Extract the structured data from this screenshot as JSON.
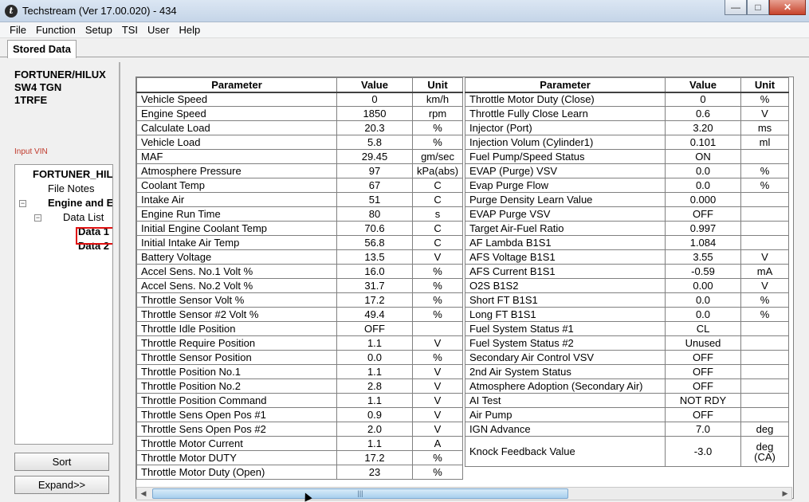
{
  "window": {
    "title": "Techstream (Ver 17.00.020) - 434",
    "minimize_icon": "minimize-icon",
    "maximize_icon": "maximize-icon",
    "close_icon": "close-icon"
  },
  "menu": [
    "File",
    "Function",
    "Setup",
    "TSI",
    "User",
    "Help"
  ],
  "tab": {
    "label": "Stored Data"
  },
  "vehicle": {
    "line1": "FORTUNER/HILUX",
    "line2": "SW4 TGN",
    "line3": "1TRFE"
  },
  "input_vin_label": "Input VIN",
  "tree": {
    "root": "FORTUNER_HIL",
    "file_notes": "File Notes",
    "engine": "Engine and E",
    "data_list": "Data List",
    "data1": "Data 1",
    "data2": "Data 2"
  },
  "buttons": {
    "sort": "Sort",
    "expand": "Expand>>"
  },
  "table_headers": {
    "parameter": "Parameter",
    "value": "Value",
    "unit": "Unit"
  },
  "left_rows": [
    {
      "param": "Vehicle Speed",
      "value": "0",
      "unit": "km/h"
    },
    {
      "param": "Engine Speed",
      "value": "1850",
      "unit": "rpm"
    },
    {
      "param": "Calculate Load",
      "value": "20.3",
      "unit": "%"
    },
    {
      "param": "Vehicle Load",
      "value": "5.8",
      "unit": "%"
    },
    {
      "param": "MAF",
      "value": "29.45",
      "unit": "gm/sec"
    },
    {
      "param": "Atmosphere Pressure",
      "value": "97",
      "unit": "kPa(abs)"
    },
    {
      "param": "Coolant Temp",
      "value": "67",
      "unit": "C"
    },
    {
      "param": "Intake Air",
      "value": "51",
      "unit": "C"
    },
    {
      "param": "Engine Run Time",
      "value": "80",
      "unit": "s"
    },
    {
      "param": "Initial Engine Coolant Temp",
      "value": "70.6",
      "unit": "C"
    },
    {
      "param": "Initial Intake Air Temp",
      "value": "56.8",
      "unit": "C"
    },
    {
      "param": "Battery Voltage",
      "value": "13.5",
      "unit": "V"
    },
    {
      "param": "Accel Sens. No.1 Volt %",
      "value": "16.0",
      "unit": "%"
    },
    {
      "param": "Accel Sens. No.2 Volt %",
      "value": "31.7",
      "unit": "%"
    },
    {
      "param": "Throttle Sensor Volt %",
      "value": "17.2",
      "unit": "%"
    },
    {
      "param": "Throttle Sensor #2 Volt %",
      "value": "49.4",
      "unit": "%"
    },
    {
      "param": "Throttle Idle Position",
      "value": "OFF",
      "unit": ""
    },
    {
      "param": "Throttle Require Position",
      "value": "1.1",
      "unit": "V"
    },
    {
      "param": "Throttle Sensor Position",
      "value": "0.0",
      "unit": "%"
    },
    {
      "param": "Throttle Position No.1",
      "value": "1.1",
      "unit": "V"
    },
    {
      "param": "Throttle Position No.2",
      "value": "2.8",
      "unit": "V"
    },
    {
      "param": "Throttle Position Command",
      "value": "1.1",
      "unit": "V"
    },
    {
      "param": "Throttle Sens Open Pos #1",
      "value": "0.9",
      "unit": "V"
    },
    {
      "param": "Throttle Sens Open Pos #2",
      "value": "2.0",
      "unit": "V"
    },
    {
      "param": "Throttle Motor Current",
      "value": "1.1",
      "unit": "A"
    },
    {
      "param": "Throttle Motor DUTY",
      "value": "17.2",
      "unit": "%"
    },
    {
      "param": "Throttle Motor Duty (Open)",
      "value": "23",
      "unit": "%"
    }
  ],
  "right_rows": [
    {
      "param": "Throttle Motor Duty (Close)",
      "value": "0",
      "unit": "%"
    },
    {
      "param": "Throttle Fully Close Learn",
      "value": "0.6",
      "unit": "V"
    },
    {
      "param": "Injector (Port)",
      "value": "3.20",
      "unit": "ms"
    },
    {
      "param": "Injection Volum (Cylinder1)",
      "value": "0.101",
      "unit": "ml"
    },
    {
      "param": "Fuel Pump/Speed Status",
      "value": "ON",
      "unit": ""
    },
    {
      "param": "EVAP (Purge) VSV",
      "value": "0.0",
      "unit": "%"
    },
    {
      "param": "Evap Purge Flow",
      "value": "0.0",
      "unit": "%"
    },
    {
      "param": "Purge Density Learn Value",
      "value": "0.000",
      "unit": ""
    },
    {
      "param": "EVAP Purge VSV",
      "value": "OFF",
      "unit": ""
    },
    {
      "param": "Target Air-Fuel Ratio",
      "value": "0.997",
      "unit": ""
    },
    {
      "param": "AF Lambda B1S1",
      "value": "1.084",
      "unit": ""
    },
    {
      "param": "AFS Voltage B1S1",
      "value": "3.55",
      "unit": "V"
    },
    {
      "param": "AFS Current B1S1",
      "value": "-0.59",
      "unit": "mA"
    },
    {
      "param": "O2S B1S2",
      "value": "0.00",
      "unit": "V"
    },
    {
      "param": "Short FT B1S1",
      "value": "0.0",
      "unit": "%"
    },
    {
      "param": "Long FT B1S1",
      "value": "0.0",
      "unit": "%"
    },
    {
      "param": "Fuel System Status #1",
      "value": "CL",
      "unit": ""
    },
    {
      "param": "Fuel System Status #2",
      "value": "Unused",
      "unit": ""
    },
    {
      "param": "Secondary Air Control VSV",
      "value": "OFF",
      "unit": ""
    },
    {
      "param": "2nd Air System Status",
      "value": "OFF",
      "unit": ""
    },
    {
      "param": "Atmosphere Adoption (Secondary Air)",
      "value": "OFF",
      "unit": ""
    },
    {
      "param": "AI Test",
      "value": "NOT RDY",
      "unit": ""
    },
    {
      "param": "Air Pump",
      "value": "OFF",
      "unit": ""
    },
    {
      "param": "IGN Advance",
      "value": "7.0",
      "unit": "deg"
    },
    {
      "param": "Knock Feedback Value",
      "value": "-3.0",
      "unit": "deg (CA)"
    }
  ],
  "scrollbar": {
    "grip": "|||",
    "left_arrow": "◀",
    "right_arrow": "▶"
  }
}
